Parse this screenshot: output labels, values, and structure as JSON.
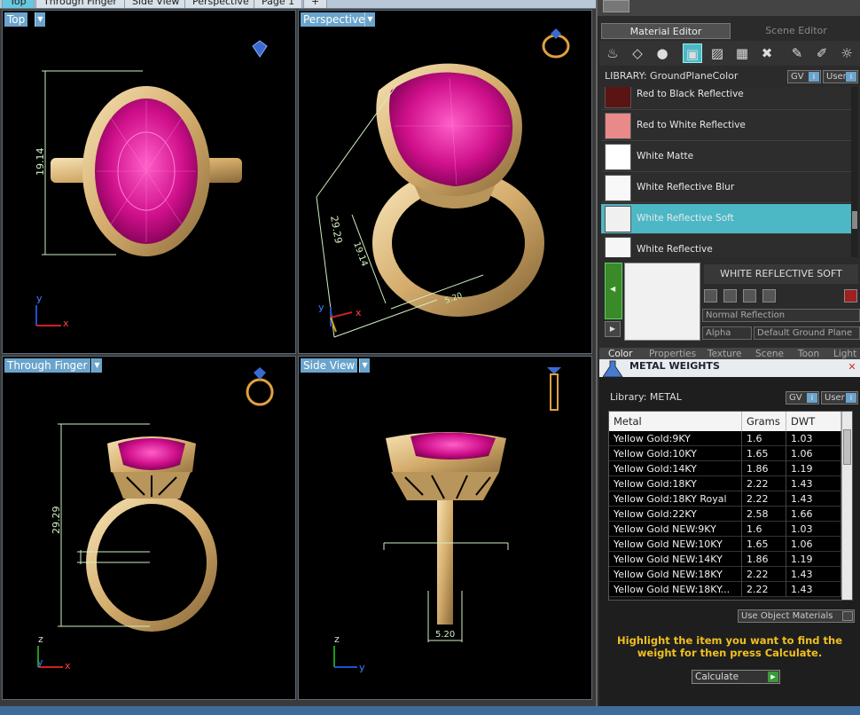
{
  "view_tabs": [
    "Top",
    "Through Finger",
    "Side View",
    "Perspective",
    "Page 1",
    "+"
  ],
  "viewports": {
    "top": {
      "label": "Top",
      "dimension": "19.14",
      "axis_y": "y",
      "axis_x": "x"
    },
    "perspective": {
      "label": "Perspective",
      "dim_a": "29.29",
      "dim_b": "19.14",
      "dim_c": "5.20",
      "axis_y": "y",
      "axis_x": "x"
    },
    "through_finger": {
      "label": "Through Finger",
      "dimension": "29.29",
      "axis_z": "z",
      "axis_y": "y",
      "axis_x": "x"
    },
    "side_view": {
      "label": "Side View",
      "dimension": "5.20",
      "axis_z": "z",
      "axis_y": "y"
    }
  },
  "editor": {
    "tab_material": "Material Editor",
    "tab_scene": "Scene Editor",
    "library_label": "LIBRARY: GroundPlaneColor",
    "gv": "GV",
    "user": "User",
    "materials": [
      {
        "name": "Red to Black Reflective",
        "color": "#5a1414"
      },
      {
        "name": "Red to White Reflective",
        "color": "#e88a8a"
      },
      {
        "name": "White Matte",
        "color": "#ffffff"
      },
      {
        "name": "White Reflective Blur",
        "color": "#f8f8f8"
      },
      {
        "name": "White Reflective Soft",
        "color": "#f0f0f0",
        "selected": true
      },
      {
        "name": "White Reflective",
        "color": "#f6f6f6"
      }
    ],
    "selected_title": "WHITE REFLECTIVE SOFT",
    "reflection_mode": "Normal Reflection",
    "alpha_label": "Alpha",
    "ground_plane": "Default Ground Plane",
    "sub_tabs": [
      "Color",
      "Properties",
      "Texture",
      "Scene",
      "Toon",
      "Light"
    ]
  },
  "metal_weights": {
    "title": "METAL WEIGHTS",
    "library_label": "Library: METAL",
    "gv": "GV",
    "user": "User",
    "columns": [
      "Metal",
      "Grams",
      "DWT"
    ],
    "rows": [
      [
        "Yellow Gold:9KY",
        "1.6",
        "1.03"
      ],
      [
        "Yellow Gold:10KY",
        "1.65",
        "1.06"
      ],
      [
        "Yellow Gold:14KY",
        "1.86",
        "1.19"
      ],
      [
        "Yellow Gold:18KY",
        "2.22",
        "1.43"
      ],
      [
        "Yellow Gold:18KY Royal",
        "2.22",
        "1.43"
      ],
      [
        "Yellow Gold:22KY",
        "2.58",
        "1.66"
      ],
      [
        "Yellow Gold NEW:9KY",
        "1.6",
        "1.03"
      ],
      [
        "Yellow Gold NEW:10KY",
        "1.65",
        "1.06"
      ],
      [
        "Yellow Gold NEW:14KY",
        "1.86",
        "1.19"
      ],
      [
        "Yellow Gold NEW:18KY",
        "2.22",
        "1.43"
      ],
      [
        "Yellow Gold NEW:18KY...",
        "2.22",
        "1.43"
      ]
    ],
    "use_object_materials": "Use Object Materials",
    "hint": "Highlight the item you want to find the weight for then press Calculate.",
    "calculate": "Calculate"
  },
  "colors": {
    "gem": "#e0209a",
    "gold": "#d9b97a",
    "accent": "#4cb8c6",
    "hint": "#f0c020"
  }
}
